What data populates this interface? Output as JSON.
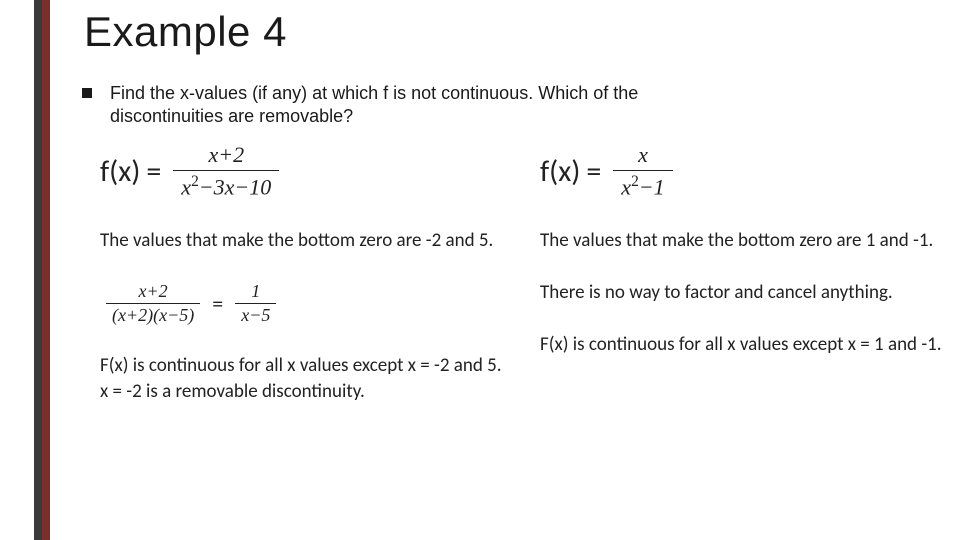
{
  "title": "Example 4",
  "bullet": "Find the x-values (if any) at which f is not continuous. Which of the discontinuities are removable?",
  "left": {
    "fx_label": "f(x)",
    "eq_sign": "=",
    "frac1_num": "x+2",
    "frac1_den_a": "x",
    "frac1_den_b": "−3x−10",
    "zeros_text": "The values that make the bottom zero are -2 and 5.",
    "frac2_num": "x+2",
    "frac2_den": "(x+2)(x−5)",
    "frac3_num": "1",
    "frac3_den": "x−5",
    "concl1": "F(x) is continuous for all x values except x = -2 and 5.",
    "concl2": "x = -2 is a removable discontinuity."
  },
  "right": {
    "fx_label": "f(x)",
    "eq_sign": "=",
    "frac1_num": "x",
    "frac1_den_a": "x",
    "frac1_den_b": "−1",
    "zeros_text": "The values that make the bottom zero are 1 and -1.",
    "nofactor": "There is no way to factor and cancel anything.",
    "concl": "F(x) is continuous for all x values except x = 1 and -1."
  }
}
